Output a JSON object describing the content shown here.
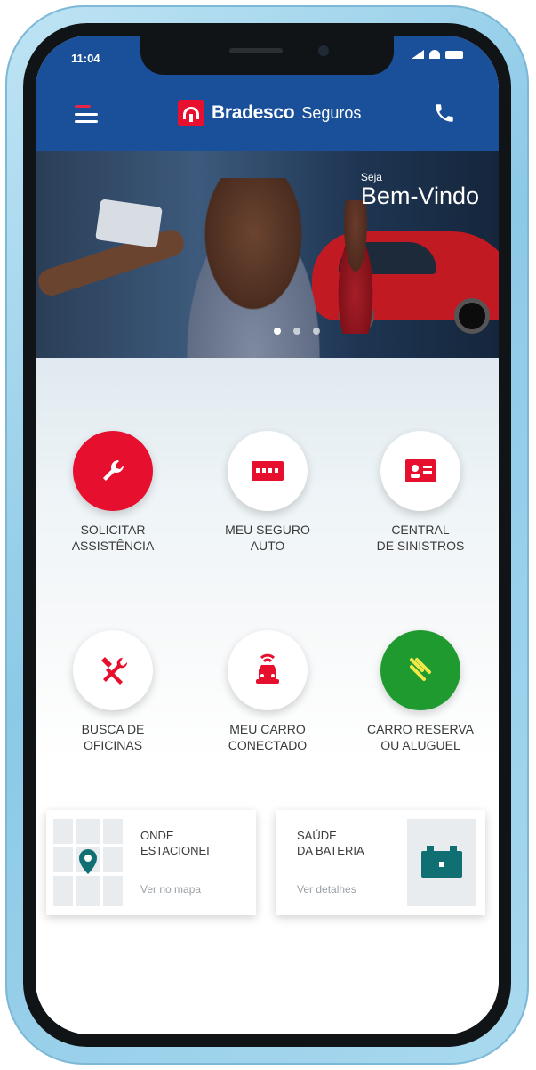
{
  "status_bar": {
    "time": "11:04"
  },
  "header": {
    "brand": "Bradesco",
    "brand_sub": "Seguros"
  },
  "hero": {
    "greeting_small": "Seja",
    "greeting_big": "Bem-Vindo",
    "slide_count": 3,
    "active_slide": 1
  },
  "services": [
    {
      "label": "SOLICITAR\nASSISTÊNCIA",
      "icon": "wrench-icon",
      "style": "red"
    },
    {
      "label": "MEU SEGURO\nAUTO",
      "icon": "insurance-card-icon",
      "style": "white"
    },
    {
      "label": "CENTRAL\nDE SINISTROS",
      "icon": "claims-icon",
      "style": "white"
    },
    {
      "label": "BUSCA DE\nOFICINAS",
      "icon": "tools-icon",
      "style": "white"
    },
    {
      "label": "MEU CARRO\nCONECTADO",
      "icon": "connected-car-icon",
      "style": "white"
    },
    {
      "label": "CARRO RESERVA\nOU ALUGUEL",
      "icon": "rental-car-icon",
      "style": "green"
    }
  ],
  "cards": [
    {
      "title": "ONDE\nESTACIONEI",
      "link": "Ver no mapa",
      "icon": "map-pin-icon"
    },
    {
      "title": "SAÚDE\nDA BATERIA",
      "link": "Ver detalhes",
      "icon": "battery-icon"
    }
  ],
  "colors": {
    "header_blue": "#1a4f9a",
    "brand_red": "#e8102e",
    "green": "#1f9a2e"
  }
}
